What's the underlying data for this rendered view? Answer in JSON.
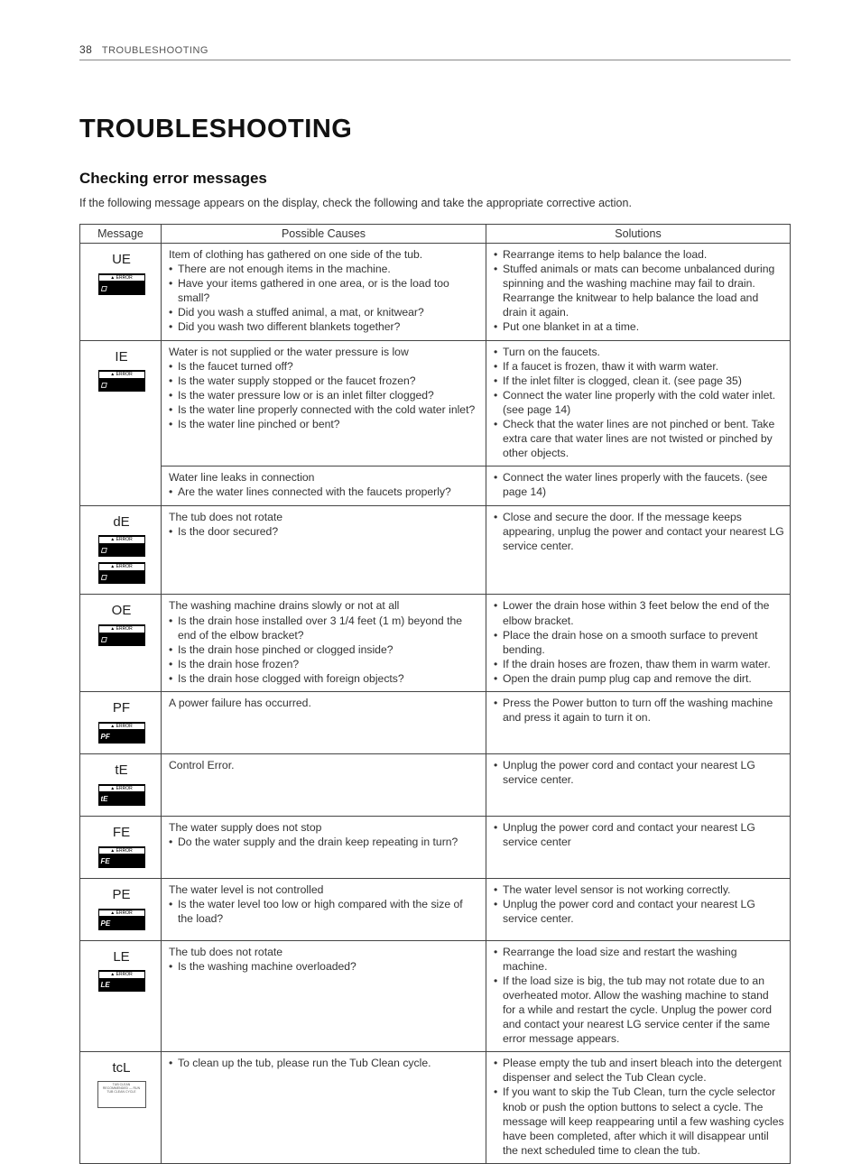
{
  "header": {
    "page_number": "38",
    "section": "TROUBLESHOOTING"
  },
  "title": "TROUBLESHOOTING",
  "subtitle": "Checking error messages",
  "intro": "If the following message appears on the display, check the following and take the appropriate corrective action.",
  "table": {
    "headers": {
      "msg": "Message",
      "causes": "Possible Causes",
      "solutions": "Solutions"
    },
    "rows": [
      {
        "code": "UE",
        "cause_lead": "Item of clothing has gathered on one side of the tub.",
        "causes": [
          "There are not enough items in the machine.",
          "Have your items gathered in one area, or is the load too small?",
          "Did you wash a stuffed animal, a mat, or knitwear?",
          "Did you wash two different blankets together?"
        ],
        "solutions": [
          "Rearrange items to help balance the load.",
          "Stuffed animals or mats can become unbalanced during spinning and the washing machine may fail to drain. Rearrange the knitwear to help balance the load and drain it again.",
          "Put one blanket in at a time."
        ]
      },
      {
        "code": "IE",
        "cause_lead": "Water is not supplied or the water pressure is low",
        "causes": [
          "Is the faucet turned off?",
          "Is the water supply stopped or the faucet frozen?",
          "Is the water pressure low or is an inlet filter clogged?",
          "Is the water line properly connected with the cold water inlet?",
          "Is the water line pinched or bent?"
        ],
        "solutions": [
          "Turn on the faucets.",
          "If a faucet is frozen, thaw it with warm water.",
          "If the inlet filter is clogged, clean it. (see page 35)",
          "Connect the water line properly with the cold water inlet. (see page 14)",
          "Check that the water lines are not pinched or bent. Take extra care that water lines are not twisted or pinched by other objects."
        ],
        "sub": {
          "cause_lead": "Water line leaks in connection",
          "causes": [
            "Are the water lines connected with the faucets properly?"
          ],
          "solutions": [
            "Connect the water lines properly with the faucets. (see page 14)"
          ]
        }
      },
      {
        "code": "dE",
        "double_badge": true,
        "cause_lead": "The tub does not rotate",
        "causes": [
          "Is the door secured?"
        ],
        "solutions": [
          "Close and secure the door. If the message keeps appearing, unplug the power and contact your nearest LG service center."
        ]
      },
      {
        "code": "OE",
        "cause_lead": "The washing machine drains slowly or not at all",
        "causes": [
          "Is the drain hose installed over 3 1/4 feet (1 m) beyond the end of the elbow bracket?",
          "Is the drain hose pinched or clogged inside?",
          "Is the drain hose frozen?",
          "Is the drain hose clogged with foreign objects?"
        ],
        "solutions": [
          "Lower the drain hose within 3 feet below the end of the elbow bracket.",
          "Place the drain hose on a smooth surface to prevent bending.",
          "If the drain hoses are frozen, thaw them in warm water.",
          "Open the drain pump plug cap and remove the dirt."
        ]
      },
      {
        "code": "PF",
        "badge_text": "PF",
        "cause_lead": "A power failure has occurred.",
        "causes": [],
        "solutions": [
          "Press the Power button to turn off the washing machine and press it again to turn it on."
        ]
      },
      {
        "code": "tE",
        "badge_text": "tE",
        "cause_lead": "Control Error.",
        "causes": [],
        "solutions": [
          "Unplug the power cord and contact your nearest LG service center."
        ]
      },
      {
        "code": "FE",
        "badge_text": "FE",
        "cause_lead": "The water supply does not stop",
        "causes": [
          "Do the water supply and the drain keep repeating in turn?"
        ],
        "solutions": [
          "Unplug the power cord and contact your nearest LG service center"
        ]
      },
      {
        "code": "PE",
        "badge_text": "PE",
        "cause_lead": "The water level is not controlled",
        "causes": [
          "Is the water level too low or high compared with the size of the load?"
        ],
        "solutions": [
          "The water level sensor is not working correctly.",
          "Unplug the power cord and contact your nearest LG service center."
        ]
      },
      {
        "code": "LE",
        "badge_text": "LE",
        "cause_lead": "The tub does not rotate",
        "causes": [
          "Is the washing machine overloaded?"
        ],
        "solutions": [
          "Rearrange the load size and restart the washing machine.",
          "If the load size is big, the tub may not rotate due to an overheated motor. Allow the washing machine to stand for a while and restart the cycle. Unplug the power cord and contact your nearest LG service center if the same error message appears."
        ]
      },
      {
        "code": "tcL",
        "tcl_badge": true,
        "cause_lead": "",
        "causes": [
          "To clean up the tub, please run the Tub Clean cycle."
        ],
        "solutions": [
          "Please empty the tub and insert bleach into the detergent dispenser and select the Tub Clean cycle.",
          "If you want to skip the Tub Clean, turn the cycle selector knob or push the option buttons to select a cycle. The message will keep reappearing until a few washing cycles have been completed, after which it will disappear until the next scheduled time to clean the tub."
        ]
      }
    ]
  }
}
